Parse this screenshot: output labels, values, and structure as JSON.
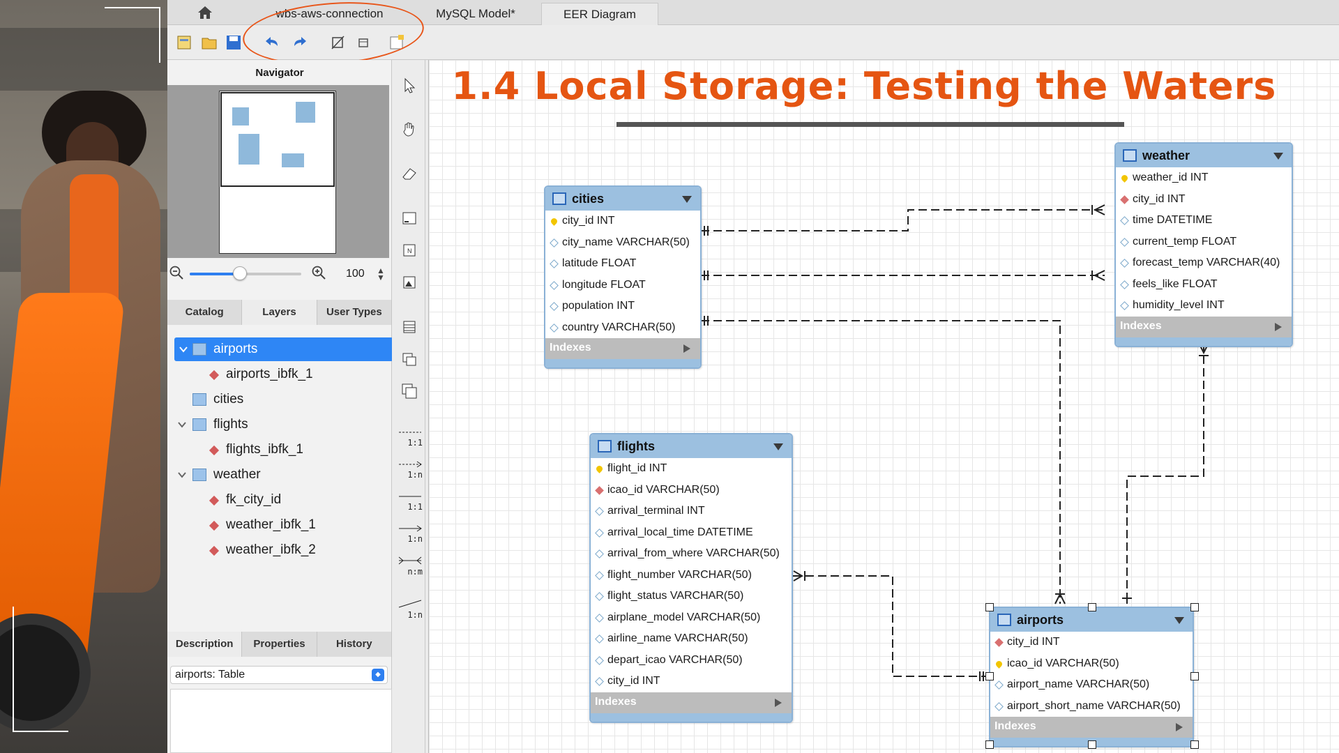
{
  "tabs": {
    "home": "home",
    "items": [
      {
        "label": "wbs-aws-connection"
      },
      {
        "label": "MySQL Model*"
      },
      {
        "label": "EER Diagram"
      }
    ]
  },
  "toolbar": {
    "icons": [
      "new-model-icon",
      "open-icon",
      "save-icon",
      "undo-icon",
      "redo-icon",
      "toggle-grid-icon",
      "align-icon",
      "new-diagram-icon"
    ]
  },
  "navigator": {
    "title": "Navigator",
    "zoom_value": "100",
    "zoom_fraction": 0.45
  },
  "catalog_tabs": [
    "Catalog",
    "Layers",
    "User Types"
  ],
  "tree": [
    {
      "label": "airports",
      "type": "table",
      "selected": true,
      "expanded": true
    },
    {
      "label": "airports_ibfk_1",
      "type": "key"
    },
    {
      "label": "cities",
      "type": "table"
    },
    {
      "label": "flights",
      "type": "table",
      "expanded": true
    },
    {
      "label": "flights_ibfk_1",
      "type": "key"
    },
    {
      "label": "weather",
      "type": "table",
      "expanded": true
    },
    {
      "label": "fk_city_id",
      "type": "key"
    },
    {
      "label": "weather_ibfk_1",
      "type": "key"
    },
    {
      "label": "weather_ibfk_2",
      "type": "key"
    }
  ],
  "bottom_tabs": [
    "Description",
    "Properties",
    "History"
  ],
  "description_select": "airports: Table",
  "relationship_tools": [
    "1:1",
    "1:n",
    "1:1",
    "1:n",
    "n:m",
    "1:n"
  ],
  "slide_title": "1.4 Local Storage: Testing the Waters",
  "tables": {
    "cities": {
      "name": "cities",
      "columns": [
        {
          "kind": "pk",
          "text": "city_id INT"
        },
        {
          "kind": "col",
          "text": "city_name VARCHAR(50)"
        },
        {
          "kind": "col",
          "text": "latitude FLOAT"
        },
        {
          "kind": "col",
          "text": "longitude FLOAT"
        },
        {
          "kind": "col",
          "text": "population INT"
        },
        {
          "kind": "col",
          "text": "country VARCHAR(50)"
        }
      ],
      "indexes": "Indexes"
    },
    "weather": {
      "name": "weather",
      "columns": [
        {
          "kind": "pk",
          "text": "weather_id INT"
        },
        {
          "kind": "fk",
          "text": "city_id INT"
        },
        {
          "kind": "col",
          "text": "time DATETIME"
        },
        {
          "kind": "col",
          "text": "current_temp FLOAT"
        },
        {
          "kind": "col",
          "text": "forecast_temp VARCHAR(40)"
        },
        {
          "kind": "col",
          "text": "feels_like FLOAT"
        },
        {
          "kind": "col",
          "text": "humidity_level INT"
        }
      ],
      "indexes": "Indexes"
    },
    "flights": {
      "name": "flights",
      "columns": [
        {
          "kind": "pk",
          "text": "flight_id INT"
        },
        {
          "kind": "fk",
          "text": "icao_id VARCHAR(50)"
        },
        {
          "kind": "col",
          "text": "arrival_terminal INT"
        },
        {
          "kind": "col",
          "text": "arrival_local_time DATETIME"
        },
        {
          "kind": "col",
          "text": "arrival_from_where VARCHAR(50)"
        },
        {
          "kind": "col",
          "text": "flight_number VARCHAR(50)"
        },
        {
          "kind": "col",
          "text": "flight_status VARCHAR(50)"
        },
        {
          "kind": "col",
          "text": "airplane_model VARCHAR(50)"
        },
        {
          "kind": "col",
          "text": "airline_name VARCHAR(50)"
        },
        {
          "kind": "col",
          "text": "depart_icao VARCHAR(50)"
        },
        {
          "kind": "col",
          "text": "city_id INT"
        }
      ],
      "indexes": "Indexes"
    },
    "airports": {
      "name": "airports",
      "columns": [
        {
          "kind": "fk",
          "text": "city_id INT"
        },
        {
          "kind": "pk",
          "text": "icao_id VARCHAR(50)"
        },
        {
          "kind": "col",
          "text": "airport_name VARCHAR(50)"
        },
        {
          "kind": "col",
          "text": "airport_short_name VARCHAR(50)"
        }
      ],
      "indexes": "Indexes"
    }
  },
  "colors": {
    "accent_title": "#e55512",
    "selection": "#2e86f5",
    "table_header": "#9cc0e0"
  }
}
